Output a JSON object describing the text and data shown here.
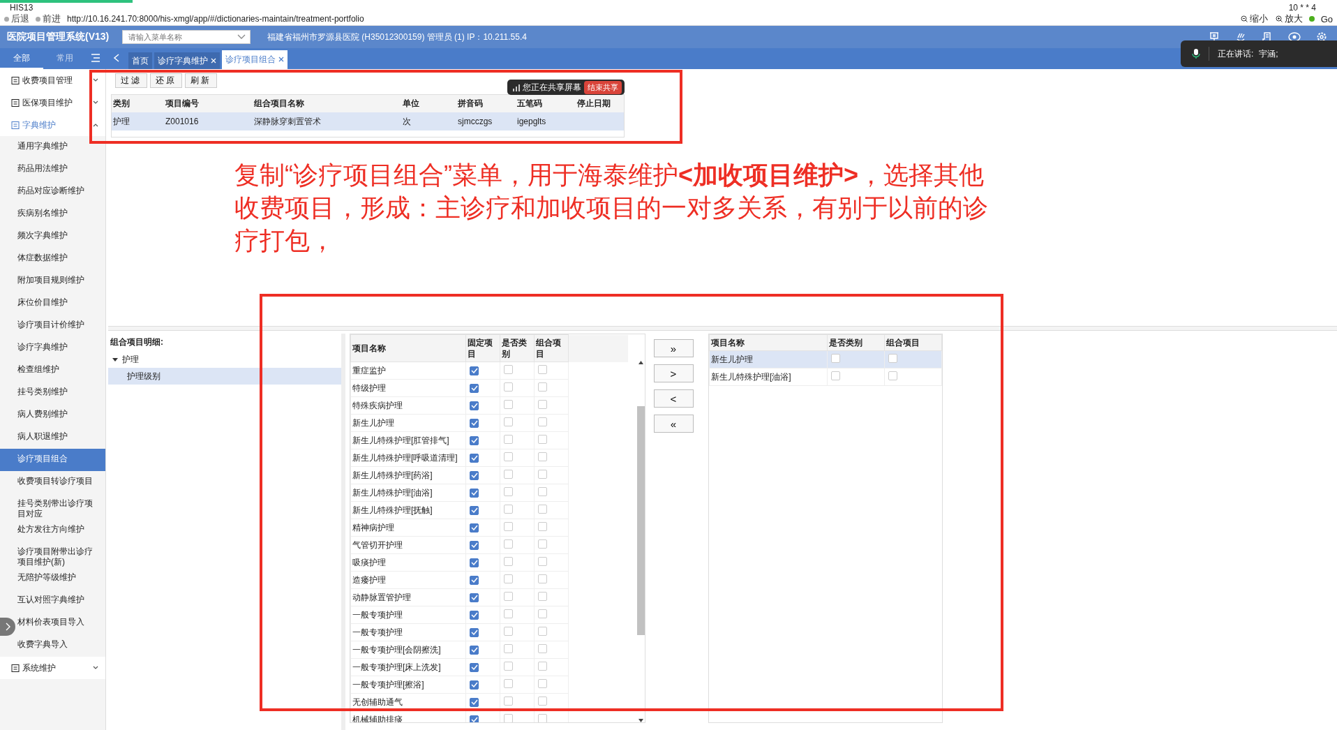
{
  "browser": {
    "tab_title": "HIS13",
    "corner_text": "10 * * 4",
    "back": "后退",
    "forward": "前进",
    "url": "http://10.16.241.70:8000/his-xmgl/app/#/dictionaries-maintain/treatment-portfolio",
    "zoom_out": "缩小",
    "zoom_in": "放大",
    "go": "Go"
  },
  "header": {
    "title": "医院项目管理系统(V13)",
    "menu_search": {
      "placeholder": "请输入菜单名称"
    },
    "info": "福建省福州市罗源县医院 (H35012300159) 管理员 (1) IP：10.211.55.4"
  },
  "nav_tabs": [
    {
      "label": "全部",
      "selected": true
    },
    {
      "label": "常用",
      "selected": false
    }
  ],
  "page_tabs": [
    {
      "label": "首页",
      "closable": false,
      "selected": false
    },
    {
      "label": "诊疗字典维护",
      "closable": true,
      "selected": false
    },
    {
      "label": "诊疗项目组合",
      "closable": true,
      "selected": true
    }
  ],
  "sidebar": {
    "items": [
      {
        "label": "收费项目管理",
        "expanded": false,
        "selected": false
      },
      {
        "label": "医保项目维护",
        "expanded": false,
        "selected": false
      },
      {
        "label": "字典维护",
        "expanded": true,
        "selected": true,
        "children": [
          {
            "label": "通用字典维护",
            "selected": false
          },
          {
            "label": "药品用法维护",
            "selected": false
          },
          {
            "label": "药品对应诊断维护",
            "selected": false
          },
          {
            "label": "疾病别名维护",
            "selected": false
          },
          {
            "label": "频次字典维护",
            "selected": false
          },
          {
            "label": "体症数据维护",
            "selected": false
          },
          {
            "label": "附加项目规则维护",
            "selected": false
          },
          {
            "label": "床位价目维护",
            "selected": false
          },
          {
            "label": "诊疗项目计价维护",
            "selected": false
          },
          {
            "label": "诊疗字典维护",
            "selected": false
          },
          {
            "label": "检查组维护",
            "selected": false
          },
          {
            "label": "挂号类别维护",
            "selected": false
          },
          {
            "label": "病人费别维护",
            "selected": false
          },
          {
            "label": "病人职退维护",
            "selected": false
          },
          {
            "label": "诊疗项目组合",
            "selected": true
          },
          {
            "label": "收费项目转诊疗项目",
            "selected": false
          },
          {
            "label": "挂号类别带出诊疗项目对应",
            "selected": false
          },
          {
            "label": "处方发往方向维护",
            "selected": false
          },
          {
            "label": "诊疗项目附带出诊疗项目维护(新)",
            "selected": false
          },
          {
            "label": "无陪护等级维护",
            "selected": false
          },
          {
            "label": "互认对照字典维护",
            "selected": false
          },
          {
            "label": "材料价表项目导入",
            "selected": false
          },
          {
            "label": "收费字典导入",
            "selected": false
          }
        ]
      },
      {
        "label": "系统维护",
        "expanded": false,
        "selected": false
      }
    ]
  },
  "toolbar": [
    "过滤",
    "还原",
    "刷新"
  ],
  "portfolio_table": {
    "columns": [
      "类别",
      "项目编号",
      "组合项目名称",
      "单位",
      "拼音码",
      "五笔码",
      "停止日期"
    ],
    "rows": [
      {
        "cells": [
          "护理",
          "Z001016",
          "深静脉穿刺置管术",
          "次",
          "sjmcczgs",
          "igepglts",
          ""
        ],
        "selected": true
      }
    ]
  },
  "share_banner": {
    "text": "您正在共享屏幕",
    "button": "结束共享"
  },
  "speaking_popup": {
    "label": "正在讲话:",
    "speaker": "宇涵;"
  },
  "annotation": "复制“诊疗项目组合”菜单，用于海泰维护**<加收项目维护>**，选择其他收费项目，形成：主诊疗和加收项目的一对多关系，有别于以前的诊疗打包，",
  "detail_tree": {
    "title": "组合项目明细:",
    "nodes": [
      {
        "label": "护理",
        "expanded": true,
        "selected": false,
        "children": [
          {
            "label": "护理级别",
            "selected": true
          }
        ]
      }
    ]
  },
  "available_items": {
    "columns": [
      "项目名称",
      "固定项目",
      "是否类别",
      "组合项目"
    ],
    "rows": [
      {
        "name": "重症监护",
        "fixed": true,
        "category": false,
        "combo": false
      },
      {
        "name": "特级护理",
        "fixed": true,
        "category": false,
        "combo": false
      },
      {
        "name": "特殊疾病护理",
        "fixed": true,
        "category": false,
        "combo": false
      },
      {
        "name": "新生儿护理",
        "fixed": true,
        "category": false,
        "combo": false
      },
      {
        "name": "新生儿特殊护理[肛管排气]",
        "fixed": true,
        "category": false,
        "combo": false
      },
      {
        "name": "新生儿特殊护理[呼吸道清理]",
        "fixed": true,
        "category": false,
        "combo": false
      },
      {
        "name": "新生儿特殊护理[药浴]",
        "fixed": true,
        "category": false,
        "combo": false
      },
      {
        "name": "新生儿特殊护理[油浴]",
        "fixed": true,
        "category": false,
        "combo": false
      },
      {
        "name": "新生儿特殊护理[抚触]",
        "fixed": true,
        "category": false,
        "combo": false
      },
      {
        "name": "精神病护理",
        "fixed": true,
        "category": false,
        "combo": false
      },
      {
        "name": "气管切开护理",
        "fixed": true,
        "category": false,
        "combo": false
      },
      {
        "name": "吸痰护理",
        "fixed": true,
        "category": false,
        "combo": false
      },
      {
        "name": "造瘘护理",
        "fixed": true,
        "category": false,
        "combo": false
      },
      {
        "name": "动静脉置管护理",
        "fixed": true,
        "category": false,
        "combo": false
      },
      {
        "name": "一般专项护理",
        "fixed": true,
        "category": false,
        "combo": false
      },
      {
        "name": "一般专项护理",
        "fixed": true,
        "category": false,
        "combo": false
      },
      {
        "name": "一般专项护理[会阴擦洗]",
        "fixed": true,
        "category": false,
        "combo": false
      },
      {
        "name": "一般专项护理[床上洗发]",
        "fixed": true,
        "category": false,
        "combo": false
      },
      {
        "name": "一般专项护理[擦浴]",
        "fixed": true,
        "category": false,
        "combo": false
      },
      {
        "name": "无创辅助通气",
        "fixed": true,
        "category": false,
        "combo": false
      },
      {
        "name": "机械辅助排痰",
        "fixed": true,
        "category": false,
        "combo": false
      }
    ]
  },
  "transfer_buttons": [
    "»",
    ">",
    "<",
    "«"
  ],
  "selected_items": {
    "columns": [
      "项目名称",
      "是否类别",
      "组合项目"
    ],
    "rows": [
      {
        "name": "新生儿护理",
        "category": false,
        "combo": false,
        "selected": true
      },
      {
        "name": "新生儿特殊护理[油浴]",
        "category": false,
        "combo": false,
        "selected": false
      }
    ]
  }
}
